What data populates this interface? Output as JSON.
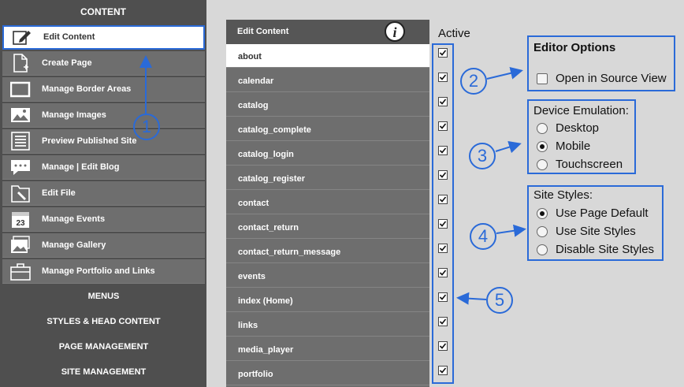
{
  "sidebar": {
    "header": "CONTENT",
    "items": [
      {
        "label": "Edit Content",
        "icon": "edit-icon",
        "active": true
      },
      {
        "label": "Create Page",
        "icon": "new-page-icon"
      },
      {
        "label": "Manage Border Areas",
        "icon": "border-areas-icon"
      },
      {
        "label": "Manage Images",
        "icon": "image-icon"
      },
      {
        "label": "Preview Published Site",
        "icon": "preview-icon"
      },
      {
        "label": "Manage | Edit Blog",
        "icon": "blog-icon"
      },
      {
        "label": "Edit File",
        "icon": "edit-file-icon"
      },
      {
        "label": "Manage Events",
        "icon": "calendar-icon"
      },
      {
        "label": "Manage Gallery",
        "icon": "gallery-icon"
      },
      {
        "label": "Manage Portfolio and Links",
        "icon": "briefcase-icon"
      }
    ],
    "sections": [
      "MENUS",
      "STYLES & HEAD CONTENT",
      "PAGE MANAGEMENT",
      "SITE MANAGEMENT"
    ]
  },
  "content_list": {
    "title": "Edit Content",
    "info_icon": "info-icon",
    "pages": [
      "about",
      "calendar",
      "catalog",
      "catalog_complete",
      "catalog_login",
      "catalog_register",
      "contact",
      "contact_return",
      "contact_return_message",
      "events",
      "index (Home)",
      "links",
      "media_player",
      "portfolio"
    ],
    "active_header": "Active",
    "active_checked": [
      true,
      true,
      true,
      true,
      true,
      true,
      true,
      true,
      true,
      true,
      true,
      true,
      true,
      true
    ]
  },
  "editor_options": {
    "title": "Editor Options",
    "source_view_label": "Open in Source View",
    "source_view_checked": false
  },
  "device_emulation": {
    "title": "Device Emulation:",
    "options": [
      "Desktop",
      "Mobile",
      "Touchscreen"
    ],
    "selected": "Mobile"
  },
  "site_styles": {
    "title": "Site Styles:",
    "options": [
      "Use Page Default",
      "Use Site Styles",
      "Disable Site Styles"
    ],
    "selected": "Use Page Default"
  },
  "callouts": [
    "1",
    "2",
    "3",
    "4",
    "5"
  ],
  "colors": {
    "annotation": "#2a6ad8",
    "sidebar_bg": "#4f4f4f",
    "item_bg": "#6e6e6e"
  }
}
